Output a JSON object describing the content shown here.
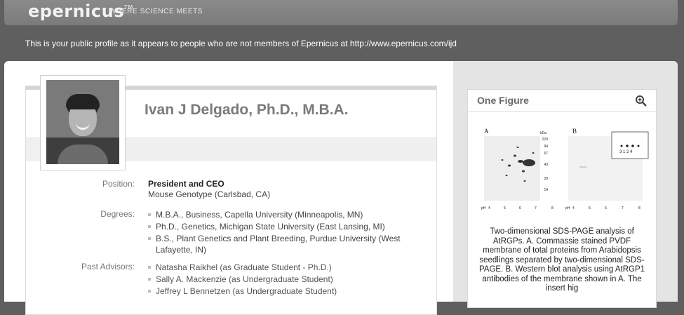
{
  "header": {
    "logo": "epernicus",
    "logo_mark": "TM",
    "tagline": "WHERE SCIENCE MEETS"
  },
  "notice": "This is your public profile as it appears to people who are not members of Epernicus at http://www.epernicus.com/ijd",
  "profile": {
    "name": "Ivan J Delgado, Ph.D., M.B.A.",
    "position_label": "Position:",
    "position_title": "President and CEO",
    "position_org": "Mouse Genotype (Carlsbad, CA)",
    "degrees_label": "Degrees:",
    "degrees": [
      "M.B.A., Business, Capella University (Minneapolis, MN)",
      "Ph.D., Genetics, Michigan State University (East Lansing, MI)",
      "B.S., Plant Genetics and Plant Breeding, Purdue University (West Lafayette, IN)"
    ],
    "advisors_label": "Past Advisors:",
    "advisors": [
      "Natasha Raikhel (as Graduate Student - Ph.D.)",
      "Sally A. Mackenzie (as Undergraduate Student)",
      "Jeffrey L Bennetzen (as Undergraduate Student)"
    ]
  },
  "figure": {
    "title": "One Figure",
    "zoom_icon": "magnifier-plus-icon",
    "panel_a": "A",
    "panel_b": "B",
    "kda": "kDa",
    "mw_ticks": [
      "220",
      "94",
      "67",
      "43",
      "29",
      "14"
    ],
    "ph_label": "pH",
    "ph_ticks": [
      "4",
      "5",
      "6",
      "7",
      "8"
    ],
    "insert_lanes": "3 1 2 4",
    "caption": "Two-dimensional SDS-PAGE analysis of AtRGPs. A. Commassie stained PVDF membrane of total proteins from Arabidopsis seedlings separated by two-dimensional SDS-PAGE. B. Western blot analysis using AtRGP1 antibodies of the membrane shown in A. The insert hig"
  }
}
